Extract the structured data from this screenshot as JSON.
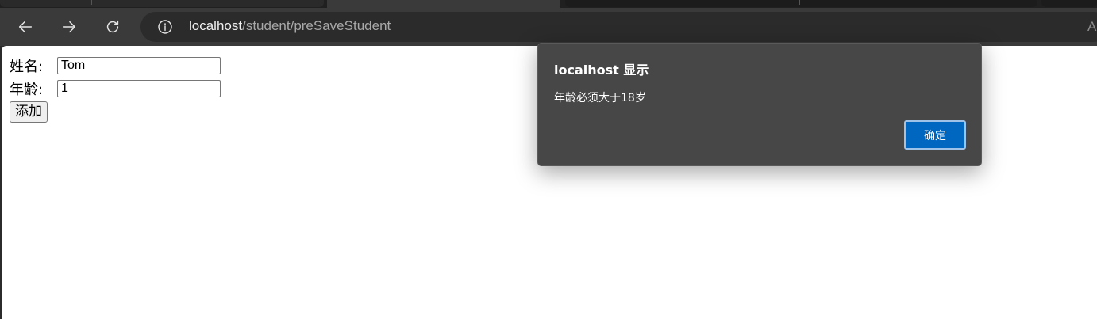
{
  "browser": {
    "address": {
      "host": "localhost",
      "path": "/student/preSaveStudent",
      "reader_label": "A"
    },
    "icons": {
      "back": "arrow-left-icon",
      "forward": "arrow-right-icon",
      "reload": "reload-icon",
      "site_info": "info-icon"
    }
  },
  "form": {
    "name_label": "姓名:",
    "name_value": "Tom",
    "age_label": "年龄:",
    "age_value": "1",
    "submit_label": "添加"
  },
  "dialog": {
    "title": "localhost 显示",
    "message": "年龄必须大于18岁",
    "ok_label": "确定",
    "accent_color": "#0067c0"
  }
}
